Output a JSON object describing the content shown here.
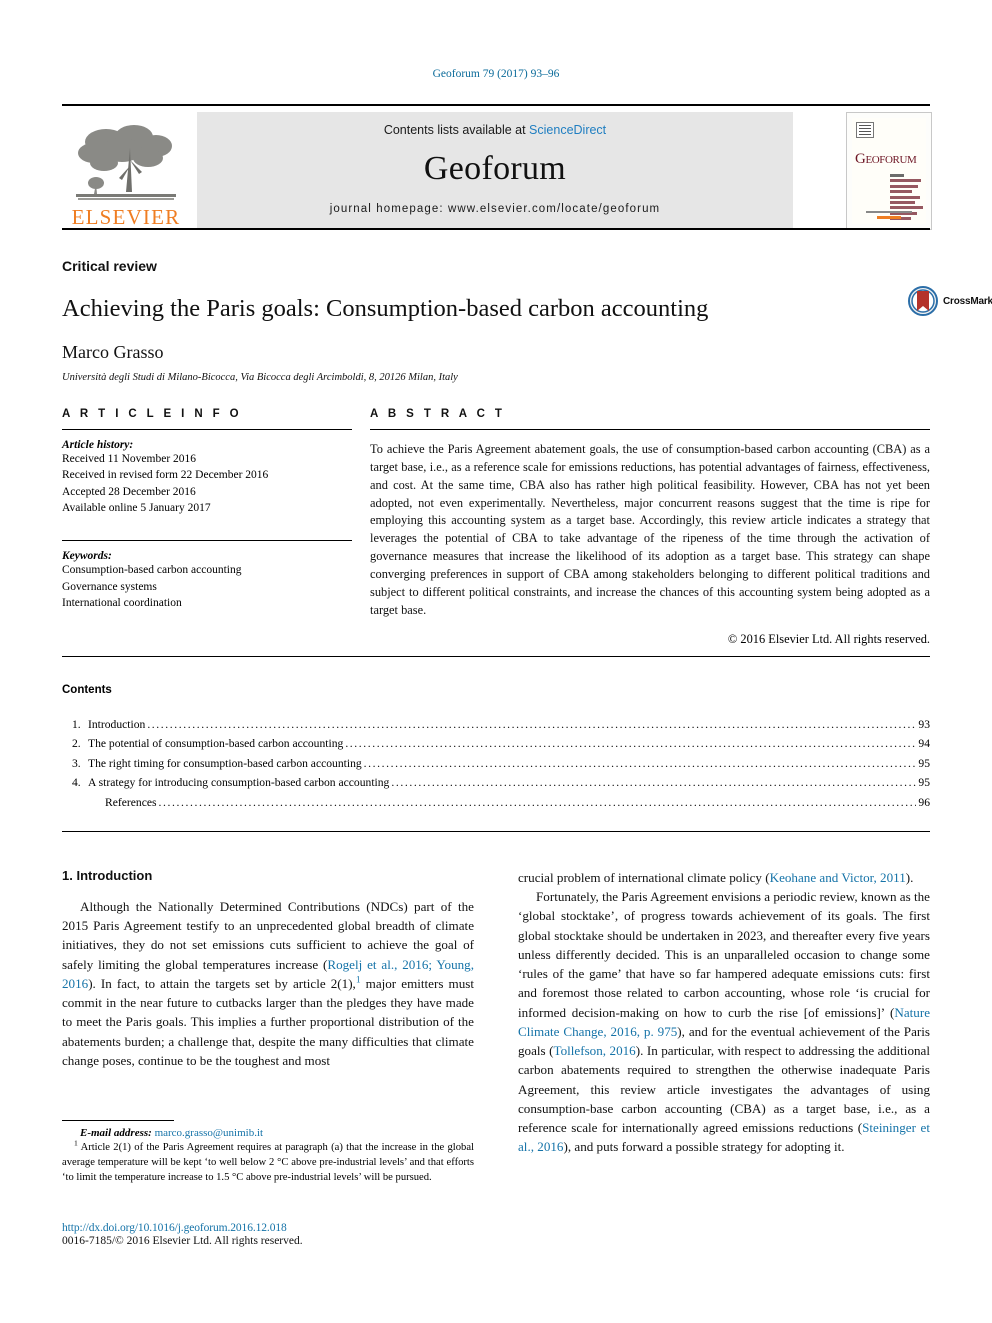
{
  "running_head": "Geoforum 79 (2017) 93–96",
  "masthead": {
    "contents_prefix": "Contents lists available at ",
    "sciencedirect": "ScienceDirect",
    "journal_name": "Geoforum",
    "homepage": "journal homepage: www.elsevier.com/locate/geoforum",
    "publisher_logo_text": "ELSEVIER",
    "cover_title_first": "G",
    "cover_title_rest": "EOFORUM",
    "accent_link": "#1f7ec1",
    "accent_orange": "#ef7d22",
    "cover_maroon": "#6e1726"
  },
  "article": {
    "doc_type": "Critical review",
    "title": "Achieving the Paris goals: Consumption-based carbon accounting",
    "authors": "Marco Grasso",
    "affiliation": "Università degli Studi di Milano-Bicocca, Via Bicocca degli Arcimboldi, 8, 20126 Milan, Italy",
    "crossmark_label": "CrossMark"
  },
  "article_info": {
    "heading": "A R T I C L E    I N F O",
    "history_label": "Article history:",
    "history": [
      "Received 11 November 2016",
      "Received in revised form 22 December 2016",
      "Accepted 28 December 2016",
      "Available online 5 January 2017"
    ],
    "keywords_label": "Keywords:",
    "keywords": [
      "Consumption-based carbon accounting",
      "Governance systems",
      "International coordination"
    ]
  },
  "abstract": {
    "heading": "A B S T R A C T",
    "text": "To achieve the Paris Agreement abatement goals, the use of consumption-based carbon accounting (CBA) as a target base, i.e., as a reference scale for emissions reductions, has potential advantages of fairness, effectiveness, and cost. At the same time, CBA also has rather high political feasibility. However, CBA has not yet been adopted, not even experimentally. Nevertheless, major concurrent reasons suggest that the time is ripe for employing this accounting system as a target base. Accordingly, this review article indicates a strategy that leverages the potential of CBA to take advantage of the ripeness of the time through the activation of governance measures that increase the likelihood of its adoption as a target base. This strategy can shape converging preferences in support of CBA among stakeholders belonging to different political traditions and subject to different political constraints, and increase the chances of this accounting system being adopted as a target base.",
    "copyright": "© 2016 Elsevier Ltd. All rights reserved."
  },
  "contents": {
    "heading": "Contents",
    "items": [
      {
        "num": "1.",
        "label": "Introduction",
        "page": "93"
      },
      {
        "num": "2.",
        "label": "The potential of consumption-based carbon accounting",
        "page": "94"
      },
      {
        "num": "3.",
        "label": "The right timing for consumption-based carbon accounting",
        "page": "95"
      },
      {
        "num": "4.",
        "label": "A strategy for introducing consumption-based carbon accounting",
        "page": "95"
      },
      {
        "num": "",
        "label": "References",
        "page": "96"
      }
    ]
  },
  "body": {
    "section_heading": "1. Introduction",
    "left_para_1_a": "Although the Nationally Determined Contributions (NDCs) part of the 2015 Paris Agreement testify to an unprecedented global breadth of climate initiatives, they do not set emissions cuts sufficient to achieve the goal of safely limiting the global temperatures increase (",
    "left_cite_1": "Rogelj et al., 2016; Young, 2016",
    "left_para_1_b": "). In fact, to attain the targets set by article 2(1),",
    "left_footnote_marker": "1",
    "left_para_1_c": " major emitters must commit in the near future to cutbacks larger than the pledges they have made to meet the Paris goals. This implies a further proportional distribution of the abatements burden; a challenge that, despite the many difficulties that climate change poses, continue to be the toughest and most",
    "right_para_1_a": "crucial problem of international climate policy (",
    "right_cite_1": "Keohane and Victor, 2011",
    "right_para_1_b": ").",
    "right_para_2_a": "Fortunately, the Paris Agreement envisions a periodic review, known as the ‘global stocktake’, of progress towards achievement of its goals. The first global stocktake should be undertaken in 2023, and thereafter every five years unless differently decided. This is an unparalleled occasion to change some ‘rules of the game’ that have so far hampered adequate emissions cuts: first and foremost those related to carbon accounting, whose role ‘is crucial for informed decision-making on how to curb the rise [of emissions]’ (",
    "right_cite_2": "Nature Climate Change, 2016, p. 975",
    "right_para_2_b": "), and for the eventual achievement of the Paris goals (",
    "right_cite_3": "Tollefson, 2016",
    "right_para_2_c": "). In particular, with respect to addressing the additional carbon abatements required to strengthen the otherwise inadequate Paris Agreement, this review article investigates the advantages of using consumption-base carbon accounting (CBA) as a target base, i.e., as a reference scale for internationally agreed emissions reductions (",
    "right_cite_4": "Steininger et al., 2016",
    "right_para_2_d": "), and puts forward a possible strategy for adopting it."
  },
  "footnotes": {
    "email_label": "E-mail address:",
    "email": "marco.grasso@unimib.it",
    "note_marker": "1",
    "note_text": "Article 2(1) of the Paris Agreement requires at paragraph (a) that the increase in the global average temperature will be kept ‘to well below 2 °C above pre-industrial levels’ and that efforts ‘to limit the temperature increase to 1.5 °C above pre-industrial levels’ will be pursued."
  },
  "page_footer": {
    "doi": "http://dx.doi.org/10.1016/j.geoforum.2016.12.018",
    "issn_line": "0016-7185/© 2016 Elsevier Ltd. All rights reserved."
  }
}
